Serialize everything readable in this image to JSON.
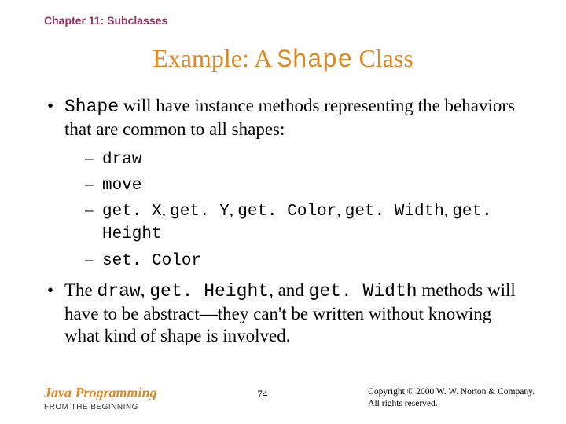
{
  "chapter": "Chapter 11: Subclasses",
  "title": {
    "pre": "Example: A ",
    "mono": "Shape",
    "post": " Class"
  },
  "bullet1": {
    "mono": "Shape",
    "rest": " will have instance methods representing the behaviors that are common to all shapes:"
  },
  "sub": {
    "i0": "draw",
    "i1": "move",
    "i2": {
      "a": "get. X",
      "b": "get. Y",
      "c": "get. Color",
      "d": "get. Width",
      "e": "get. Height"
    },
    "i3": "set. Color"
  },
  "bullet2": {
    "t0": "The ",
    "m0": "draw",
    "t1": ", ",
    "m1": "get. Height",
    "t2": ", and ",
    "m2": "get. Width",
    "t3": " methods will have to be abstract—they can't be written without knowing what kind of shape is involved."
  },
  "footer": {
    "book": "Java Programming",
    "sub": "FROM THE BEGINNING",
    "page": "74",
    "copy1": "Copyright © 2000 W. W. Norton & Company.",
    "copy2": "All rights reserved."
  }
}
